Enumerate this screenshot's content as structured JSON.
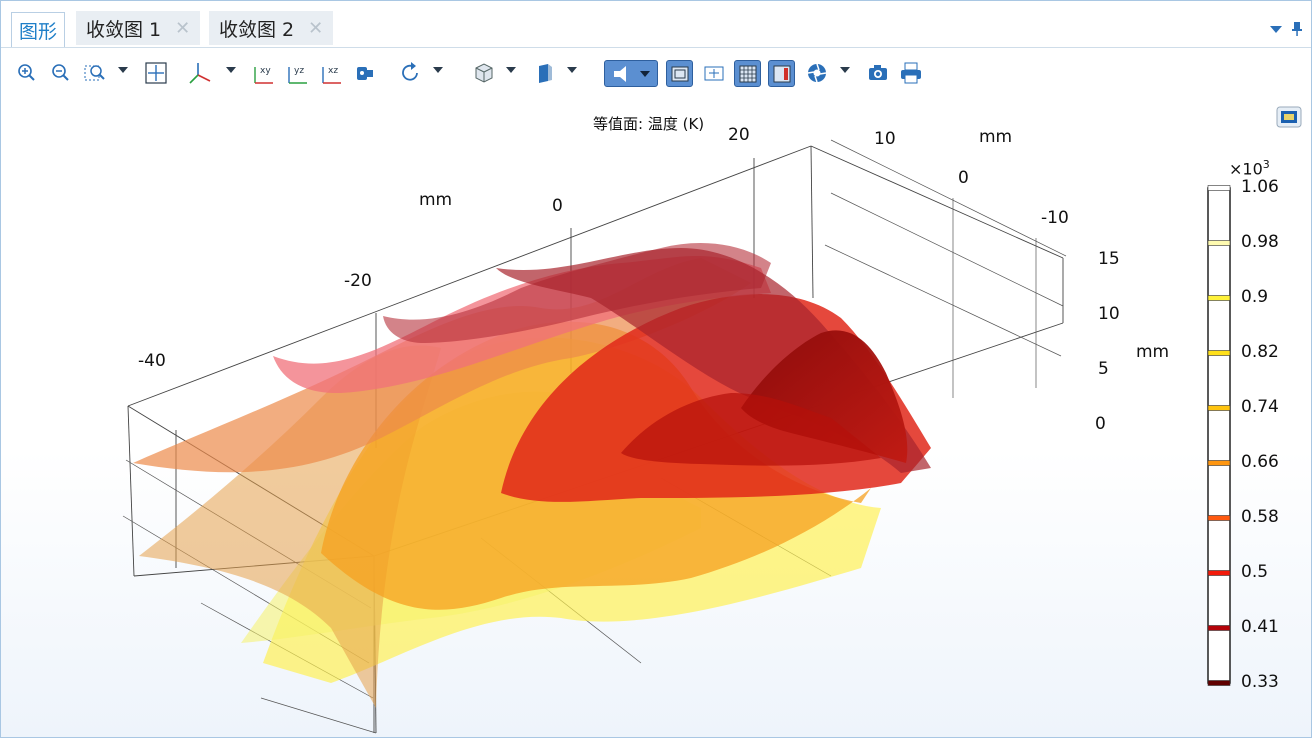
{
  "tabs": [
    {
      "label": "图形",
      "active": true
    },
    {
      "label": "收敛图 1",
      "active": false
    },
    {
      "label": "收敛图 2",
      "active": false
    }
  ],
  "toolbar": {
    "tools": [
      "zoom-in-icon",
      "zoom-out-icon",
      "zoom-box-icon",
      "zoom-extents-icon",
      "axis-orientation-icon",
      "view-xy-icon",
      "view-yz-icon",
      "view-xz-icon",
      "go-to-view-icon",
      "rotate-icon",
      "view-scene-icon",
      "transparency-icon",
      "light-icon",
      "wireframe-icon",
      "reset-view-icon",
      "grid-icon",
      "color-legend-icon",
      "render-icon",
      "snapshot-icon",
      "print-icon"
    ],
    "xy": "xy",
    "yz": "yz",
    "xz": "xz"
  },
  "plot": {
    "title": "等值面: 温度 (K)",
    "x_unit": "mm",
    "y_unit": "mm",
    "z_unit": "mm",
    "x_ticks": [
      "-40",
      "-20",
      "0",
      "20"
    ],
    "y_ticks": [
      "10",
      "0",
      "-10"
    ],
    "z_ticks": [
      "15",
      "10",
      "5",
      "0"
    ]
  },
  "colorbar": {
    "exponent_label": "×10",
    "exponent_power": "3",
    "ticks": [
      "1.06",
      "0.98",
      "0.9",
      "0.82",
      "0.74",
      "0.66",
      "0.58",
      "0.5",
      "0.41",
      "0.33"
    ],
    "tick_colors": [
      "#ffffff",
      "#fffbb0",
      "#fff23a",
      "#ffe01a",
      "#ffc40f",
      "#ff9610",
      "#ff5a10",
      "#f21a0a",
      "#b4040a",
      "#600000"
    ]
  }
}
